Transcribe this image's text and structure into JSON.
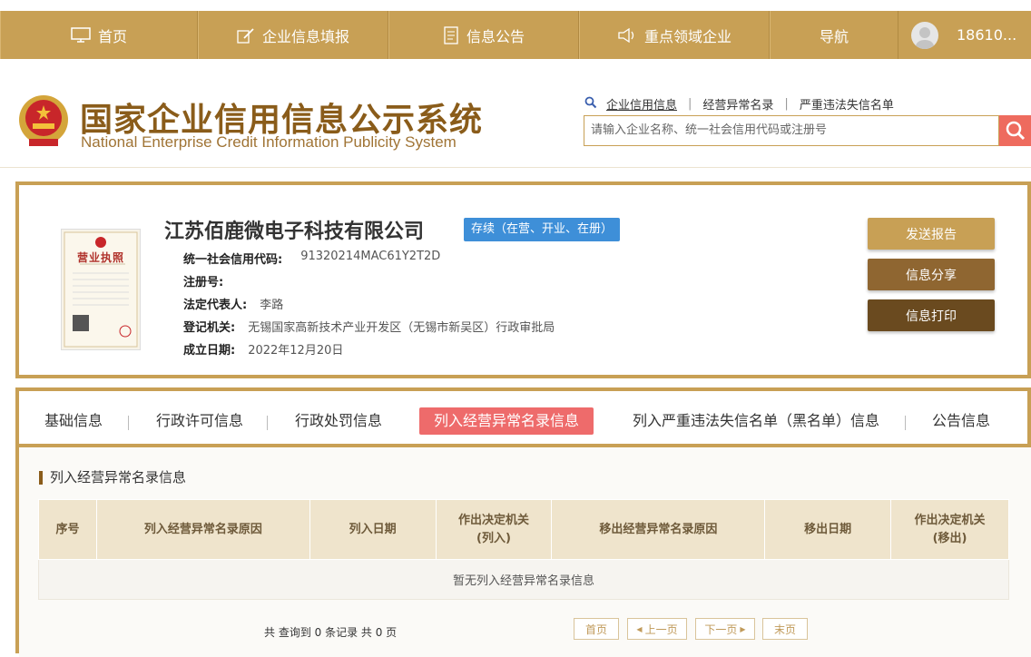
{
  "nav": {
    "items": [
      {
        "label": "首页",
        "icon": "monitor-icon"
      },
      {
        "label": "企业信息填报",
        "icon": "edit-icon"
      },
      {
        "label": "信息公告",
        "icon": "document-icon"
      },
      {
        "label": "重点领域企业",
        "icon": "speaker-icon"
      },
      {
        "label": "导航",
        "icon": ""
      }
    ],
    "user": "18610..."
  },
  "header": {
    "title": "国家企业信用信息公示系统",
    "subtitle": "National Enterprise Credit Information Publicity System",
    "search_links": [
      "企业信用信息",
      "经营异常名录",
      "严重违法失信名单"
    ],
    "search_placeholder": "请输入企业名称、统一社会信用代码或注册号"
  },
  "company": {
    "name": "江苏佰鹿微电子科技有限公司",
    "status": "存续（在营、开业、在册）",
    "license_label": "营业执照",
    "fields": [
      {
        "label": "统一社会信用代码:",
        "value": "91320214MAC61Y2T2D"
      },
      {
        "label": "注册号:",
        "value": ""
      },
      {
        "label": "法定代表人:",
        "value": "李路"
      },
      {
        "label": "登记机关:",
        "value": "无锡国家高新技术产业开发区（无锡市新吴区）行政审批局"
      },
      {
        "label": "成立日期:",
        "value": "2022年12月20日"
      }
    ],
    "buttons": {
      "report": "发送报告",
      "share": "信息分享",
      "print": "信息打印"
    }
  },
  "tabs": [
    "基础信息",
    "行政许可信息",
    "行政处罚信息",
    "列入经营异常名录信息",
    "列入严重违法失信名单（黑名单）信息",
    "公告信息"
  ],
  "section": {
    "title": "列入经营异常名录信息",
    "columns": [
      "序号",
      "列入经营异常名录原因",
      "列入日期",
      "作出决定机关\n(列入)",
      "移出经营异常名录原因",
      "移出日期",
      "作出决定机关\n(移出)"
    ],
    "empty_text": "暂无列入经营异常名录信息",
    "pager": {
      "info": "共 查询到 0 条记录 共 0 页",
      "first": "首页",
      "prev": "上一页",
      "next": "下一页",
      "last": "末页"
    }
  },
  "colors": {
    "gold": "#c8a055",
    "brown": "#8a5c1a",
    "active_tab": "#ee6b6b",
    "status_blue": "#3e8fd8"
  }
}
